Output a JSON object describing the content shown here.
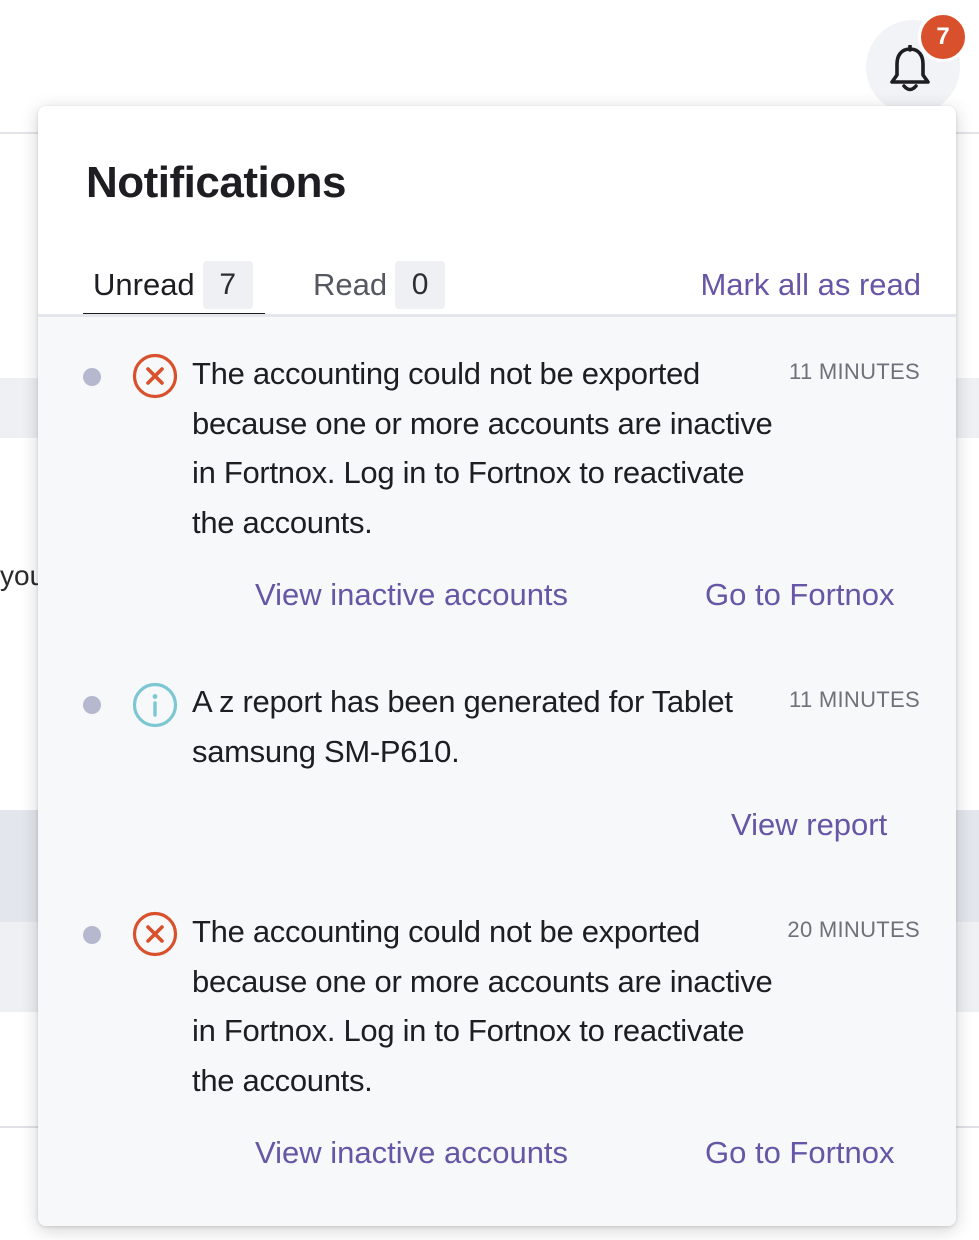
{
  "background": {
    "partial_text": "you"
  },
  "header": {
    "badge_count": "7"
  },
  "panel": {
    "title": "Notifications",
    "tabs": [
      {
        "label": "Unread",
        "count": "7"
      },
      {
        "label": "Read",
        "count": "0"
      }
    ],
    "mark_all_label": "Mark all as read"
  },
  "notifications": [
    {
      "type": "error",
      "icon": "error-circle-x-icon",
      "message": "The accounting could not be exported because one or more accounts are inactive in Fortnox. Log in to Fortnox to reactivate the accounts.",
      "time": "11 MINUTES",
      "actions": [
        "View inactive accounts",
        "Go to Fortnox"
      ]
    },
    {
      "type": "info",
      "icon": "info-circle-icon",
      "message": "A z report has been generated for Tablet samsung SM-P610.",
      "time": "11 MINUTES",
      "actions": [
        "View report"
      ]
    },
    {
      "type": "error",
      "icon": "error-circle-x-icon",
      "message": "The accounting could not be exported because one or more accounts are inactive in Fortnox. Log in to Fortnox to reactivate the accounts.",
      "time": "20 MINUTES",
      "actions": [
        "View inactive accounts",
        "Go to Fortnox"
      ]
    }
  ],
  "colors": {
    "accent": "#6656a5",
    "error": "#d9512c",
    "info": "#7cc7d3",
    "badge": "#d9512c",
    "unread_dot": "#b5b8cf"
  }
}
